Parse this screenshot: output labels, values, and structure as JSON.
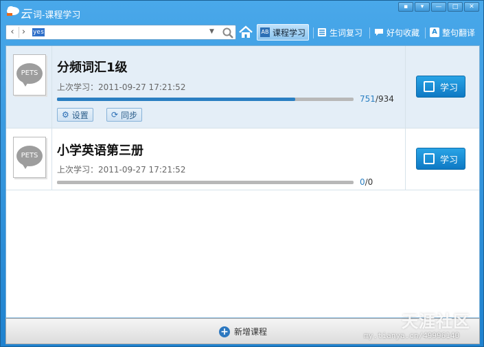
{
  "window": {
    "brand": "云",
    "title_rest": "词-课程学习"
  },
  "window_controls": [
    "▪",
    "▾",
    "—",
    "□",
    "✕"
  ],
  "toolbar": {
    "search_value": "yes",
    "tabs": [
      {
        "label": "课程学习",
        "active": true,
        "icon": "course-icon"
      },
      {
        "label": "生词复习",
        "active": false,
        "icon": "list-icon"
      },
      {
        "label": "好句收藏",
        "active": false,
        "icon": "chat-icon"
      },
      {
        "label": "整句翻译",
        "active": false,
        "icon": "translate-icon"
      }
    ]
  },
  "courses": [
    {
      "badge": "PETS",
      "title": "分频词汇1级",
      "last_study": "上次学习：2011-09-27 17:21:52",
      "progress_done": "751",
      "progress_total": "/934",
      "progress_fraction": 0.804,
      "settings_label": "设置",
      "sync_label": "同步",
      "study_label": "学习",
      "selected": true
    },
    {
      "badge": "PETS",
      "title": "小学英语第三册",
      "last_study": "上次学习：2011-09-27 17:21:52",
      "progress_done": "0",
      "progress_total": "/0",
      "progress_fraction": 0,
      "study_label": "学习",
      "selected": false
    }
  ],
  "bottom": {
    "add_course_label": "新增课程"
  },
  "watermark": {
    "big": "天涯社区",
    "small": "my.tianya.cn/49996140"
  },
  "colors": {
    "accent": "#2a7fc2",
    "title_bar": "#2a8fd6",
    "selected_row": "#e4eef7"
  }
}
